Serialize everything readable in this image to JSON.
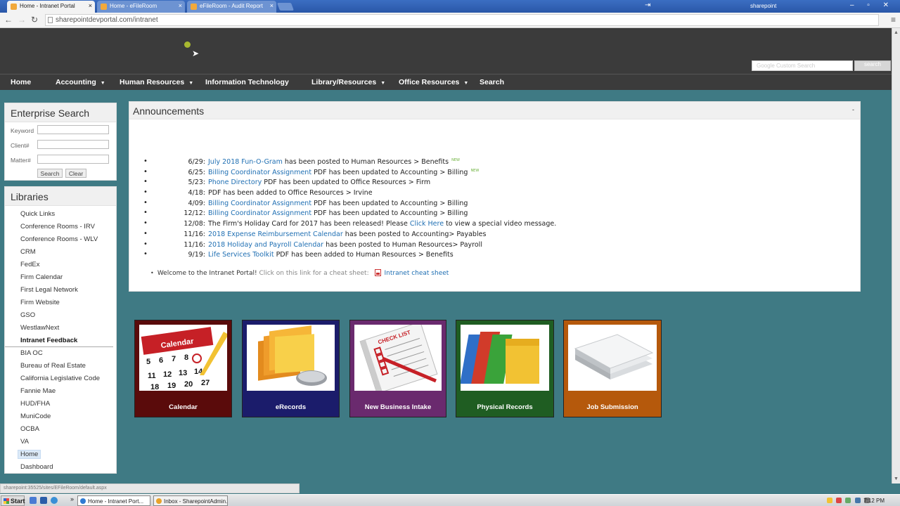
{
  "browser": {
    "tabs": [
      {
        "title": "Home - Intranet Portal",
        "active": true
      },
      {
        "title": "Home - eFileRoom",
        "active": false
      },
      {
        "title": "eFileRoom - Audit Report",
        "active": false
      }
    ],
    "tab_close": "×",
    "window_title": "sharepoint",
    "url": "sharepointdevportal.com/intranet",
    "status_url": "sharepoint:35525/sites/EFileRoom/default.aspx"
  },
  "header": {
    "search_placeholder": "Google Custom Search",
    "search_button": "search"
  },
  "topnav": [
    {
      "label": "Home",
      "dropdown": false
    },
    {
      "label": "Accounting",
      "dropdown": true
    },
    {
      "label": "Human Resources",
      "dropdown": true
    },
    {
      "label": "Information Technology",
      "dropdown": false
    },
    {
      "label": "Library/Resources",
      "dropdown": true
    },
    {
      "label": "Office Resources",
      "dropdown": true
    },
    {
      "label": "Search",
      "dropdown": false
    }
  ],
  "enterprise_search": {
    "title": "Enterprise Search",
    "fields": [
      "Keyword",
      "Client#",
      "Matter#"
    ],
    "search_button": "Search",
    "clear_button": "Clear"
  },
  "libraries": {
    "title": "Libraries",
    "items": [
      "Quick Links",
      "Conference Rooms - IRV",
      "Conference Rooms - WLV",
      "CRM",
      "FedEx",
      "Firm Calendar",
      "First Legal Network",
      "Firm Website",
      "GSO",
      "WestlawNext",
      "Intranet Feedback",
      "BIA OC",
      "Bureau of Real Estate",
      "California Legislative Code",
      "Fannie Mae",
      "HUD/FHA",
      "MuniCode",
      "OCBA",
      "VA",
      "Home",
      "Dashboard"
    ],
    "bold_item": "Intranet Feedback",
    "selected_item": "Home"
  },
  "announcements": {
    "title": "Announcements",
    "collapse": "-",
    "items": [
      {
        "date": "6/29:",
        "link": "July 2018 Fun-O-Gram",
        "text": " has been posted to Human Resources > Benefits",
        "new": true
      },
      {
        "date": "6/25:",
        "link": "Billing Coordinator Assignment",
        "text": " PDF has been updated to Accounting > Billing",
        "new": true
      },
      {
        "date": "5/23:",
        "link": "Phone Directory",
        "text": " PDF has been updated to Office Resources > Firm",
        "new": false
      },
      {
        "date": "4/18:",
        "link": "",
        "text": "PDF has been added to Office Resources > Irvine",
        "new": false
      },
      {
        "date": "4/09:",
        "link": "Billing Coordinator Assignment",
        "text": " PDF has been updated to Accounting > Billing",
        "new": false
      },
      {
        "date": "12/12:",
        "link": "Billing Coordinator Assignment",
        "text": " PDF has been updated to Accounting > Billing",
        "new": false
      },
      {
        "date": "12/08:",
        "pre": "The Firm's Holiday Card for 2017 has been released! Please ",
        "link": "Click Here",
        "text": " to view a special video message.",
        "new": false
      },
      {
        "date": "11/16:",
        "link": "2018 Expense Reimbursement Calendar",
        "text": " has been posted to Accounting> Payables",
        "new": false
      },
      {
        "date": "11/16:",
        "link": "2018 Holiday and Payroll Calendar",
        "text": " has been posted to Human Resources> Payroll",
        "new": false
      },
      {
        "date": "9/19:",
        "link": "Life Services Toolkit",
        "text": " PDF has been added to Human Resources > Benefits",
        "new": false
      }
    ],
    "new_tag": "NEW",
    "welcome_bold": "Welcome to the Intranet Portal!",
    "welcome_text": " Click on this link for a cheat sheet: ",
    "welcome_link": "Intranet cheat sheet"
  },
  "tiles": [
    {
      "label": "Calendar",
      "color": "#5a0b0b"
    },
    {
      "label": "eRecords",
      "color": "#1b1c6b"
    },
    {
      "label": "New Business Intake",
      "color": "#6a2a6e"
    },
    {
      "label": "Physical Records",
      "color": "#1f5d22"
    },
    {
      "label": "Job Submission",
      "color": "#b5590c"
    }
  ],
  "taskbar": {
    "start": "Start",
    "tasks": [
      "Home - Intranet Port...",
      "Inbox - SharepointAdmin..."
    ],
    "clock": "7:12 PM"
  }
}
